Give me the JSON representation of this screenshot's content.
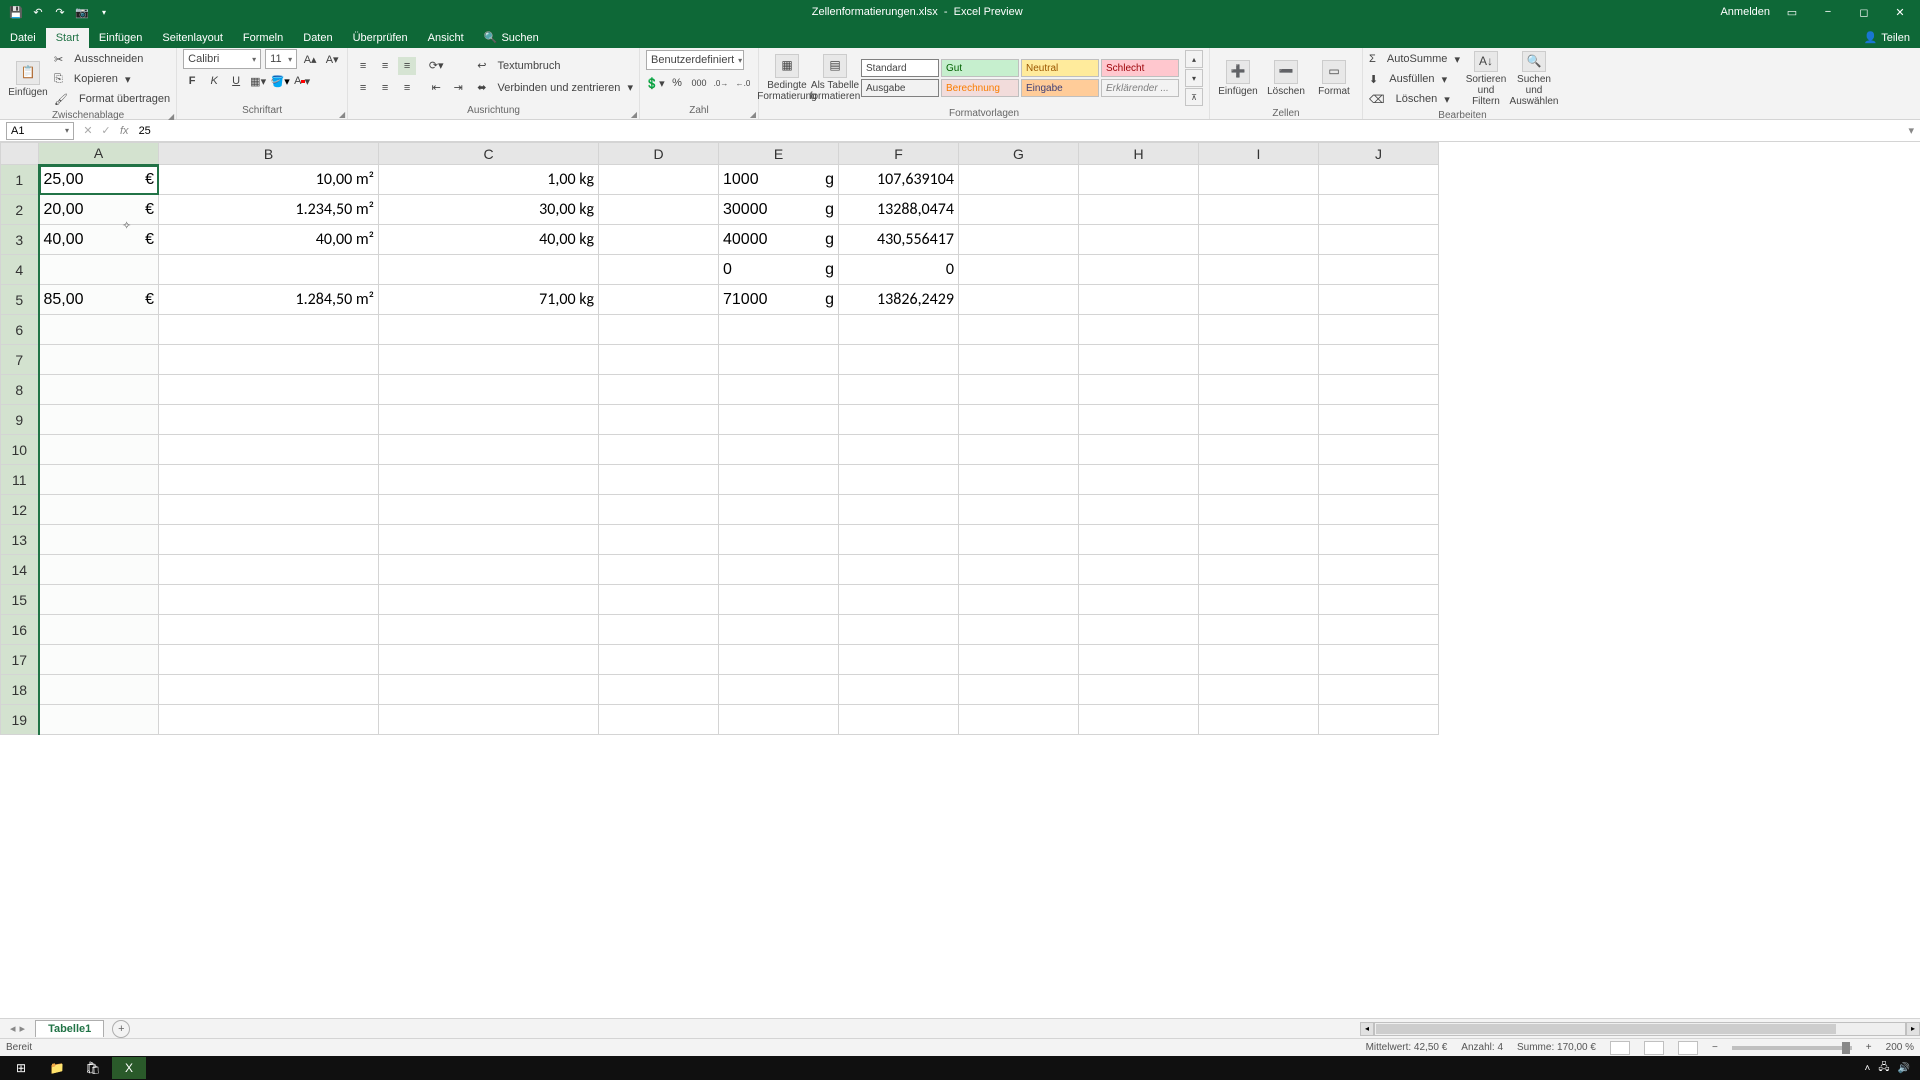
{
  "titlebar": {
    "filename": "Zellenformatierungen.xlsx",
    "appname": "Excel Preview",
    "signin": "Anmelden"
  },
  "tabs": {
    "file": "Datei",
    "items": [
      "Start",
      "Einfügen",
      "Seitenlayout",
      "Formeln",
      "Daten",
      "Überprüfen",
      "Ansicht"
    ],
    "active": "Start",
    "search": "Suchen",
    "share": "Teilen"
  },
  "ribbon": {
    "clipboard": {
      "paste": "Einfügen",
      "cut": "Ausschneiden",
      "copy": "Kopieren",
      "formatpainter": "Format übertragen",
      "label": "Zwischenablage"
    },
    "font": {
      "name": "Calibri",
      "size": "11",
      "label": "Schriftart"
    },
    "alignment": {
      "wrap": "Textumbruch",
      "merge": "Verbinden und zentrieren",
      "label": "Ausrichtung"
    },
    "number": {
      "format": "Benutzerdefiniert",
      "label": "Zahl"
    },
    "styles": {
      "cond": "Bedingte Formatierung",
      "astable": "Als Tabelle formatieren",
      "cells": [
        "Standard",
        "Gut",
        "Neutral",
        "Schlecht",
        "Ausgabe",
        "Berechnung",
        "Eingabe",
        "Erklärender ..."
      ],
      "label": "Formatvorlagen"
    },
    "cells": {
      "insert": "Einfügen",
      "delete": "Löschen",
      "format": "Format",
      "label": "Zellen"
    },
    "editing": {
      "autosum": "AutoSumme",
      "fill": "Ausfüllen",
      "clear": "Löschen",
      "sort": "Sortieren und Filtern",
      "find": "Suchen und Auswählen",
      "label": "Bearbeiten"
    }
  },
  "formulabar": {
    "namebox": "A1",
    "value": "25"
  },
  "columns": [
    "A",
    "B",
    "C",
    "D",
    "E",
    "F",
    "G",
    "H",
    "I",
    "J"
  ],
  "selected_column": "A",
  "active_cell": "A1",
  "rows": 19,
  "cells": {
    "A1": {
      "num": "25,00",
      "unit": "€"
    },
    "B1": {
      "txt": "10,00 m²"
    },
    "C1": {
      "txt": "1,00 kg"
    },
    "E1": {
      "num": "1000",
      "unit": "g"
    },
    "F1": {
      "txt": "107,639104"
    },
    "A2": {
      "num": "20,00",
      "unit": "€"
    },
    "B2": {
      "txt": "1.234,50 m²"
    },
    "C2": {
      "txt": "30,00 kg"
    },
    "E2": {
      "num": "30000",
      "unit": "g"
    },
    "F2": {
      "txt": "13288,0474"
    },
    "A3": {
      "num": "40,00",
      "unit": "€"
    },
    "B3": {
      "txt": "40,00 m²"
    },
    "C3": {
      "txt": "40,00 kg"
    },
    "E3": {
      "num": "40000",
      "unit": "g"
    },
    "F3": {
      "txt": "430,556417"
    },
    "E4": {
      "num": "0",
      "unit": "g"
    },
    "F4": {
      "txt": "0"
    },
    "A5": {
      "num": "85,00",
      "unit": "€"
    },
    "B5": {
      "txt": "1.284,50 m²"
    },
    "C5": {
      "txt": "71,00 kg"
    },
    "E5": {
      "num": "71000",
      "unit": "g"
    },
    "F5": {
      "txt": "13826,2429"
    }
  },
  "sheet": {
    "name": "Tabelle1"
  },
  "statusbar": {
    "ready": "Bereit",
    "avg_label": "Mittelwert:",
    "avg_val": "42,50 €",
    "count_label": "Anzahl:",
    "count_val": "4",
    "sum_label": "Summe:",
    "sum_val": "170,00 €",
    "zoom": "200 %"
  }
}
